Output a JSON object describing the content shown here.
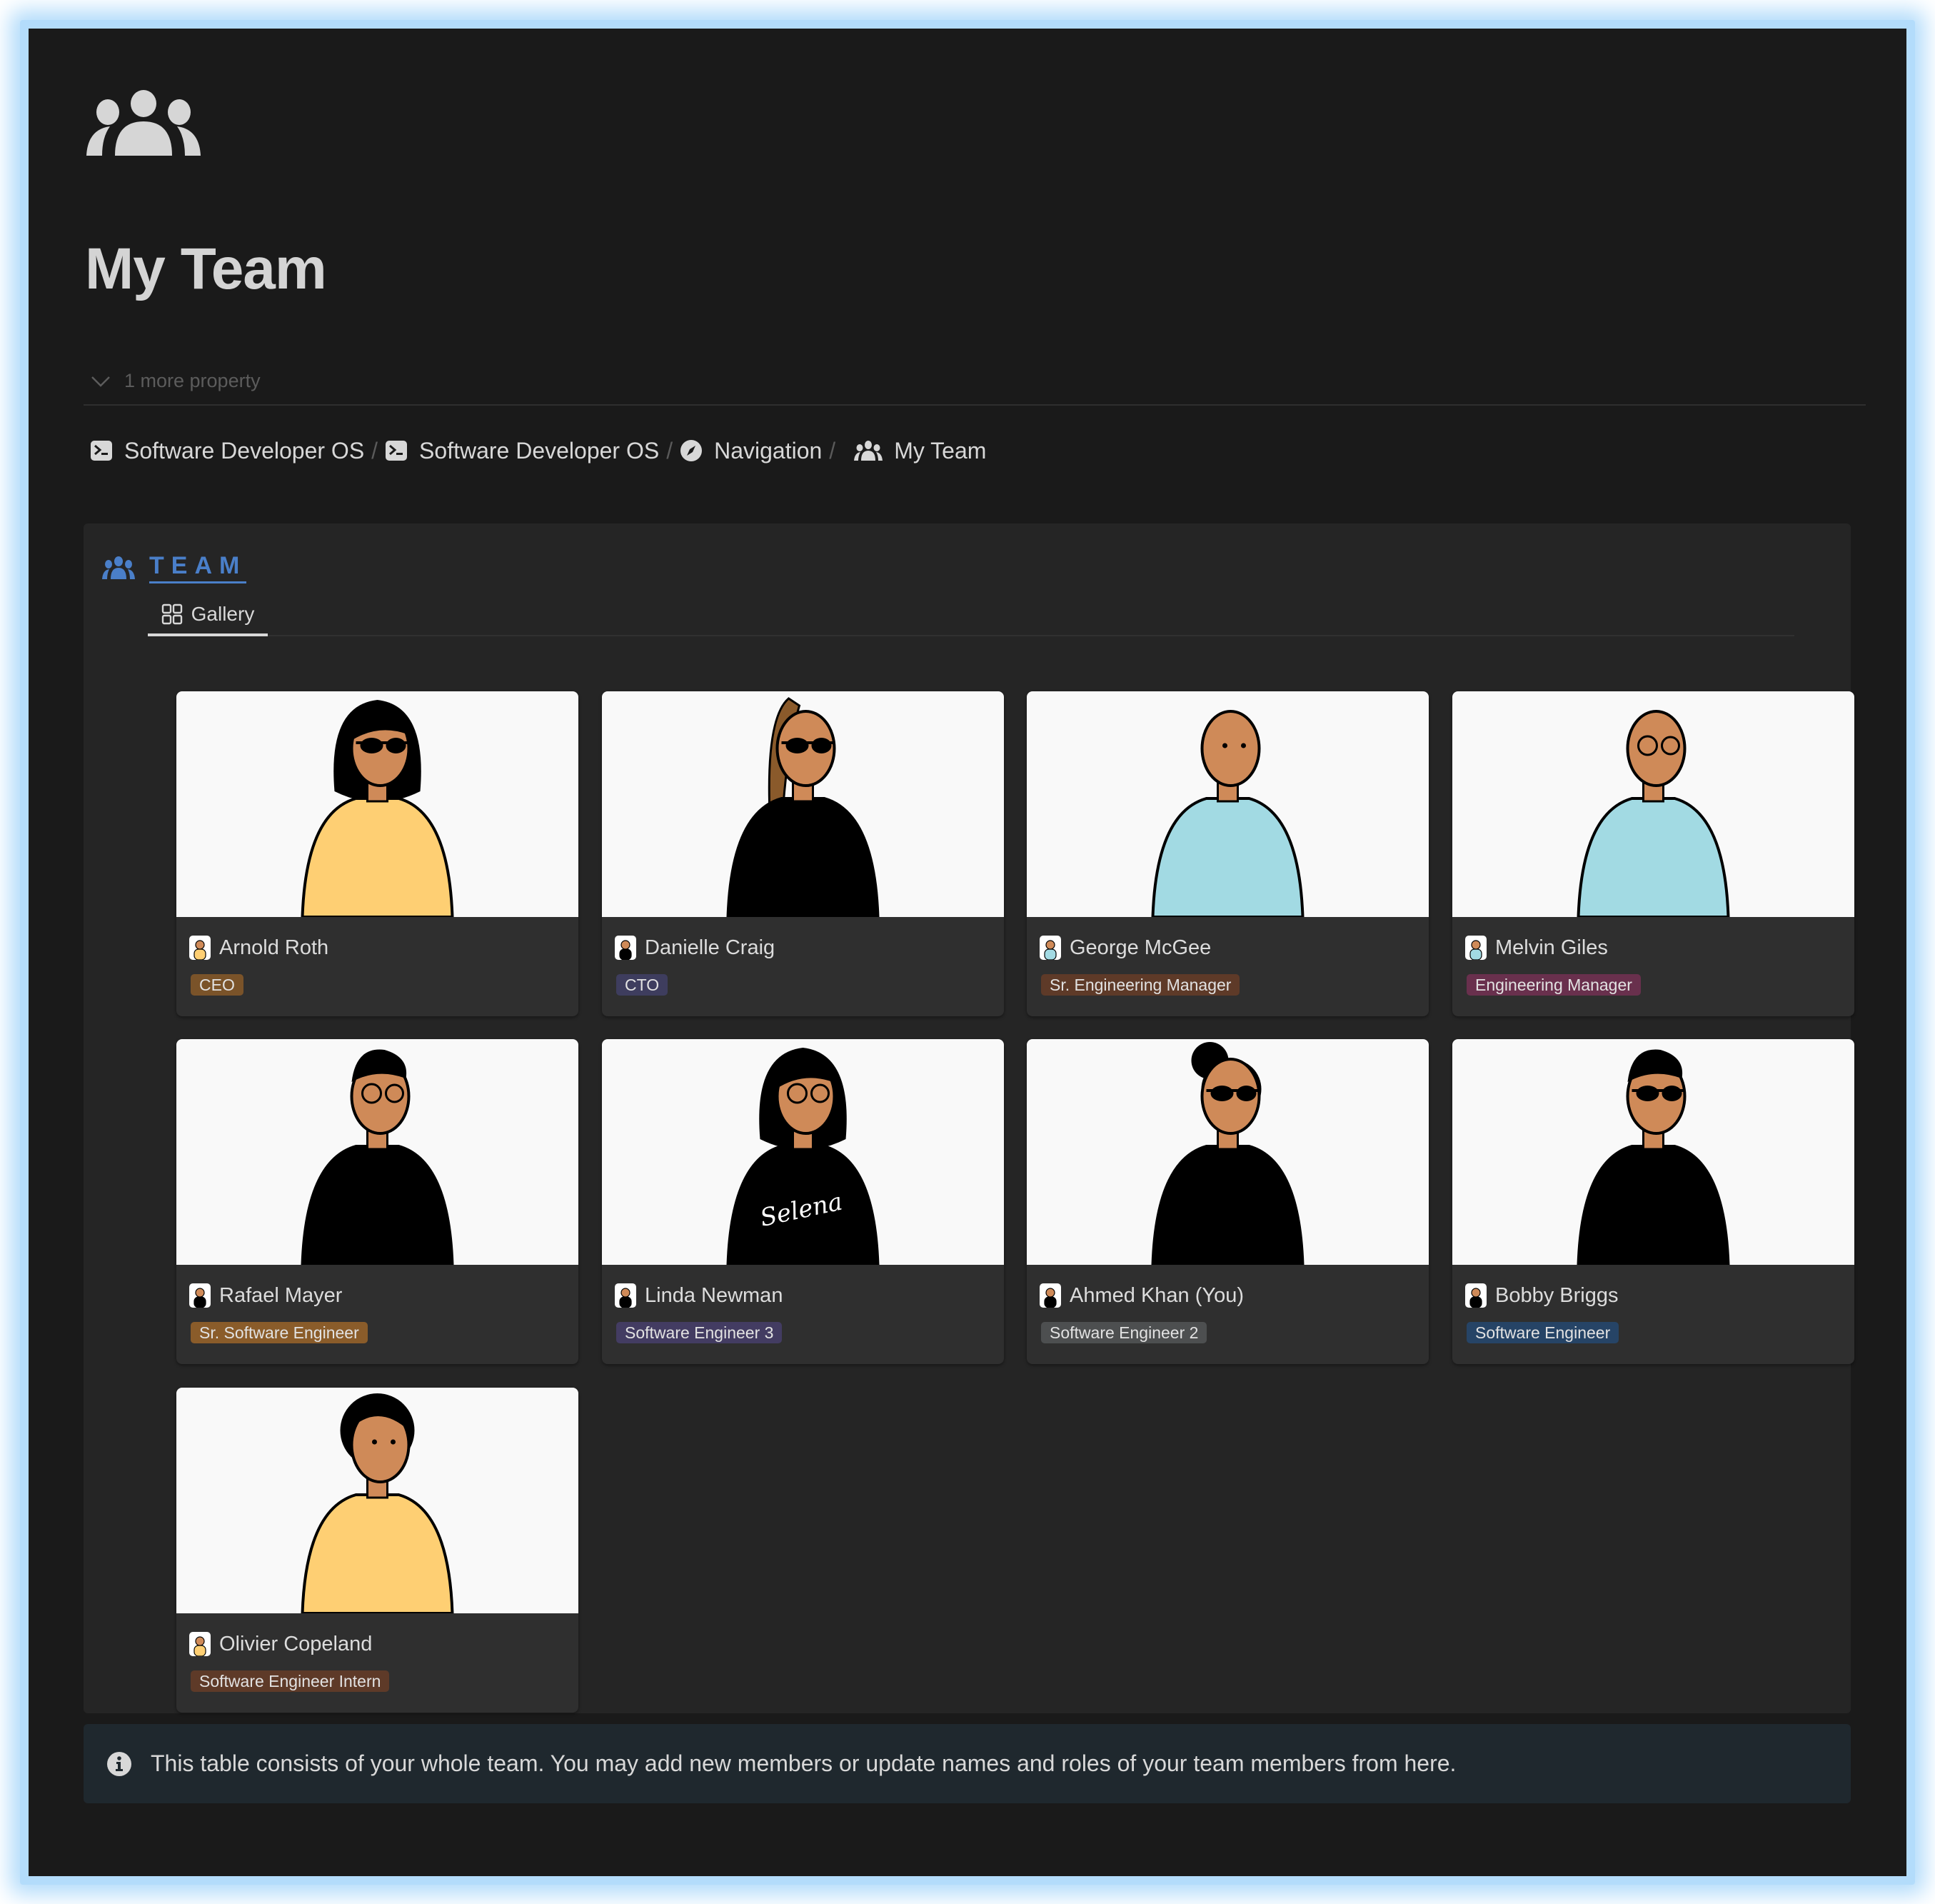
{
  "page": {
    "icon": "team-icon",
    "title": "My Team",
    "more_properties_label": "1 more property"
  },
  "breadcrumb": [
    {
      "label": "Software Developer OS",
      "icon": "terminal-icon"
    },
    {
      "label": "Software Developer OS",
      "icon": "terminal-icon"
    },
    {
      "label": "Navigation",
      "icon": "compass-icon"
    },
    {
      "label": "My Team",
      "icon": "team-icon"
    }
  ],
  "breadcrumb_separator": "/",
  "database": {
    "title": "TEAM",
    "icon": "team-icon",
    "accent_color": "#4a7fc9",
    "views": [
      {
        "label": "Gallery",
        "icon": "gallery-grid-icon",
        "active": true
      }
    ],
    "cards": [
      {
        "name": "Arnold Roth",
        "role": "CEO",
        "role_color": "#7a5329",
        "illustration": {
          "skin": "#cf8a58",
          "shirt": "#fecf73",
          "hair": "long",
          "glasses": "sunglasses"
        }
      },
      {
        "name": "Danielle Craig",
        "role": "CTO",
        "role_color": "#3e3d5e",
        "illustration": {
          "skin": "#cf8a58",
          "shirt": "#000000",
          "hair": "braids",
          "glasses": "sunglasses"
        }
      },
      {
        "name": "George McGee",
        "role": "Sr. Engineering Manager",
        "role_color": "#5e3a28",
        "illustration": {
          "skin": "#cf8a58",
          "shirt": "#a2dae3",
          "hair": "bald",
          "glasses": "none"
        }
      },
      {
        "name": "Melvin Giles",
        "role": "Engineering Manager",
        "role_color": "#69304d",
        "illustration": {
          "skin": "#cf8a58",
          "shirt": "#a2dae3",
          "hair": "bald",
          "glasses": "glasses"
        }
      },
      {
        "name": "Rafael Mayer",
        "role": "Sr. Software Engineer",
        "role_color": "#8a5c2a",
        "illustration": {
          "skin": "#cf8a58",
          "shirt": "#000000",
          "hair": "short",
          "glasses": "glasses"
        }
      },
      {
        "name": "Linda Newman",
        "role": "Software Engineer 3",
        "role_color": "#433c62",
        "illustration": {
          "skin": "#cf8a58",
          "shirt": "#000000",
          "hair": "long",
          "glasses": "glasses",
          "shirt_text": "Selena"
        }
      },
      {
        "name": "Ahmed Khan (You)",
        "role": "Software Engineer 2",
        "role_color": "#4d4f50",
        "illustration": {
          "skin": "#cf8a58",
          "shirt": "#000000",
          "hair": "bun",
          "glasses": "sunglasses"
        }
      },
      {
        "name": "Bobby Briggs",
        "role": "Software Engineer",
        "role_color": "#264466",
        "illustration": {
          "skin": "#cf8a58",
          "shirt": "#000000",
          "hair": "short",
          "glasses": "sunglasses"
        }
      },
      {
        "name": "Olivier Copeland",
        "role": "Software Engineer Intern",
        "role_color": "#5e3a28",
        "illustration": {
          "skin": "#cf8a58",
          "shirt": "#fecf73",
          "hair": "curly",
          "glasses": "none"
        }
      }
    ]
  },
  "callout": {
    "icon": "info-icon",
    "text": "This table consists of your whole team. You may add new members or update names and roles of your team members from here."
  }
}
